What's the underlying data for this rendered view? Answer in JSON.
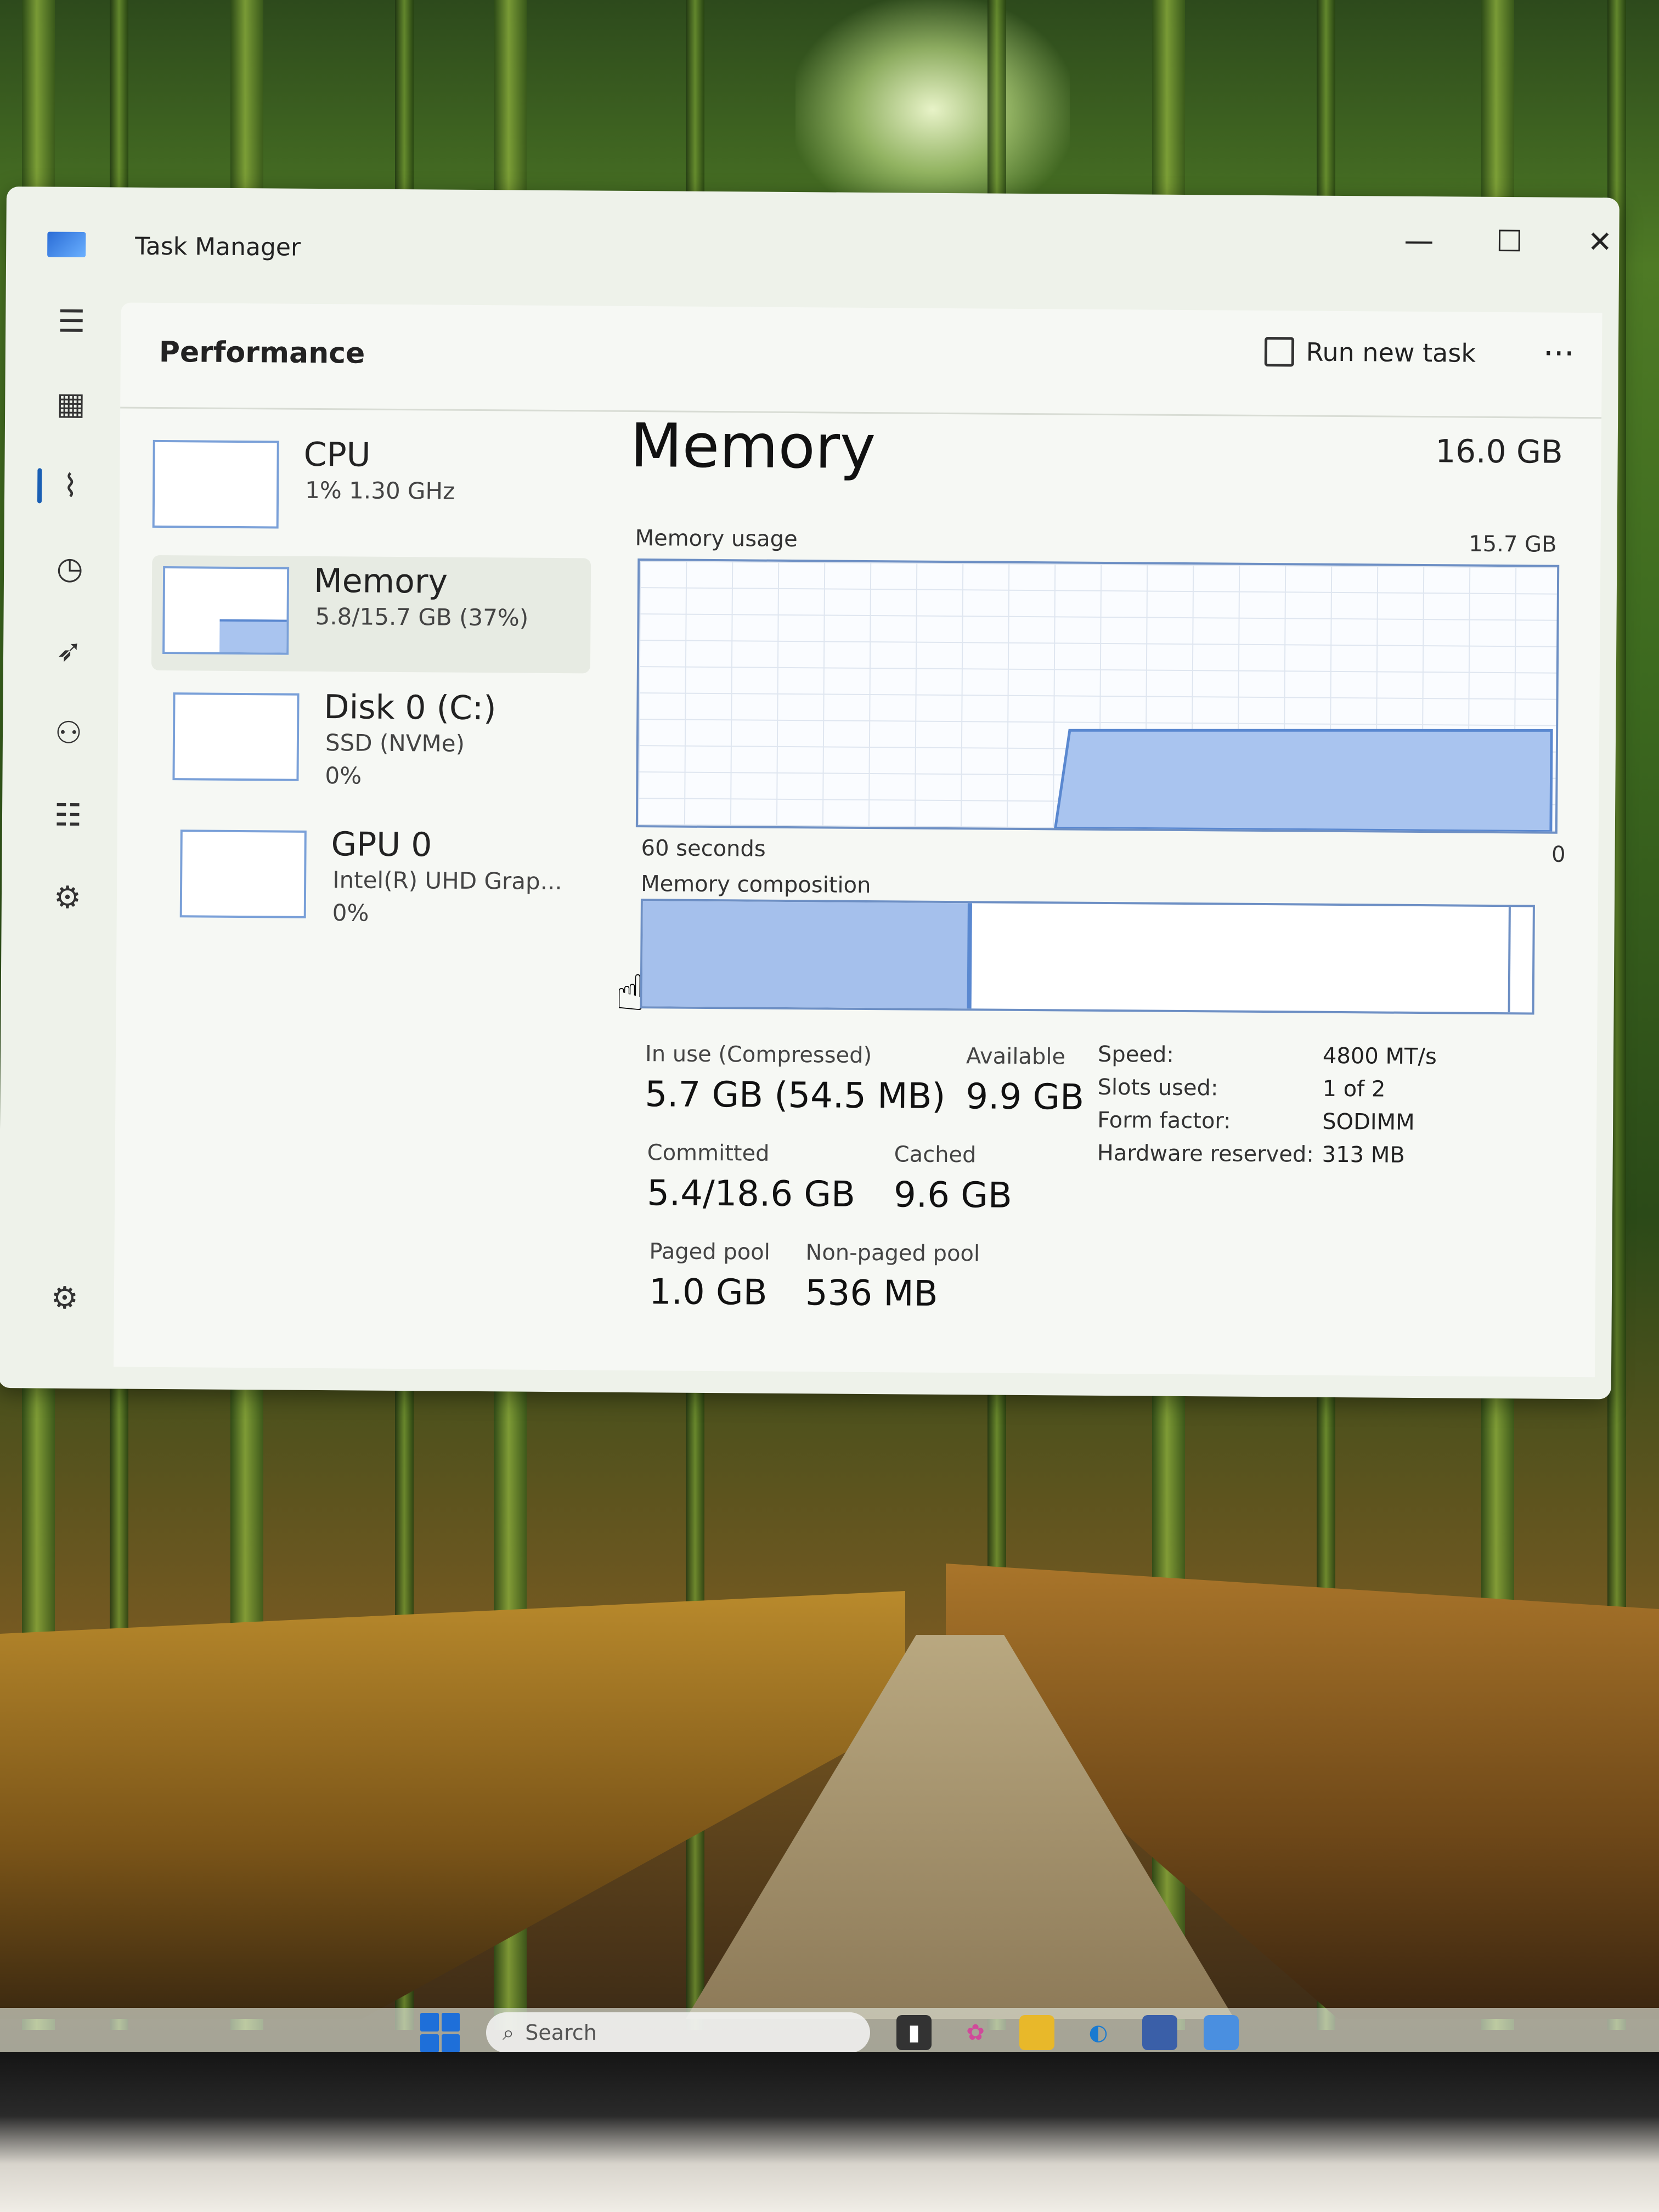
{
  "window": {
    "title": "Task Manager",
    "minimize": "—",
    "maximize": "☐",
    "close": "✕"
  },
  "header": {
    "section_title": "Performance",
    "run_new_task": "Run new task",
    "more": "···"
  },
  "devices": [
    {
      "name": "CPU",
      "sub1": "1% 1.30 GHz",
      "sub2": "",
      "fill": 0.01
    },
    {
      "name": "Memory",
      "sub1": "5.8/15.7 GB (37%)",
      "sub2": "",
      "fill": 0.37
    },
    {
      "name": "Disk 0 (C:)",
      "sub1": "SSD (NVMe)",
      "sub2": "0%",
      "fill": 0.0
    },
    {
      "name": "GPU 0",
      "sub1": "Intel(R) UHD Grap...",
      "sub2": "0%",
      "fill": 0.0
    }
  ],
  "memory": {
    "title": "Memory",
    "total": "16.0 GB",
    "usage_label": "Memory usage",
    "usage_max": "15.7 GB",
    "time_left": "60 seconds",
    "time_right": "0",
    "composition_label": "Memory composition",
    "in_use_fraction": 0.37,
    "usage_level": 0.37,
    "stats": {
      "in_use_label": "In use (Compressed)",
      "in_use_value": "5.7 GB (54.5 MB)",
      "available_label": "Available",
      "available_value": "9.9 GB",
      "committed_label": "Committed",
      "committed_value": "5.4/18.6 GB",
      "cached_label": "Cached",
      "cached_value": "9.6 GB",
      "paged_label": "Paged pool",
      "paged_value": "1.0 GB",
      "nonpaged_label": "Non-paged pool",
      "nonpaged_value": "536 MB"
    },
    "specs": {
      "speed_label": "Speed:",
      "speed_value": "4800 MT/s",
      "slots_label": "Slots used:",
      "slots_value": "1 of 2",
      "form_label": "Form factor:",
      "form_value": "SODIMM",
      "hw_label": "Hardware reserved:",
      "hw_value": "313 MB"
    }
  },
  "taskbar": {
    "search_placeholder": "Search"
  },
  "colors": {
    "accent": "#1a5fb4",
    "graph_fill": "#a9c4ef",
    "graph_line": "#5a88d0"
  }
}
